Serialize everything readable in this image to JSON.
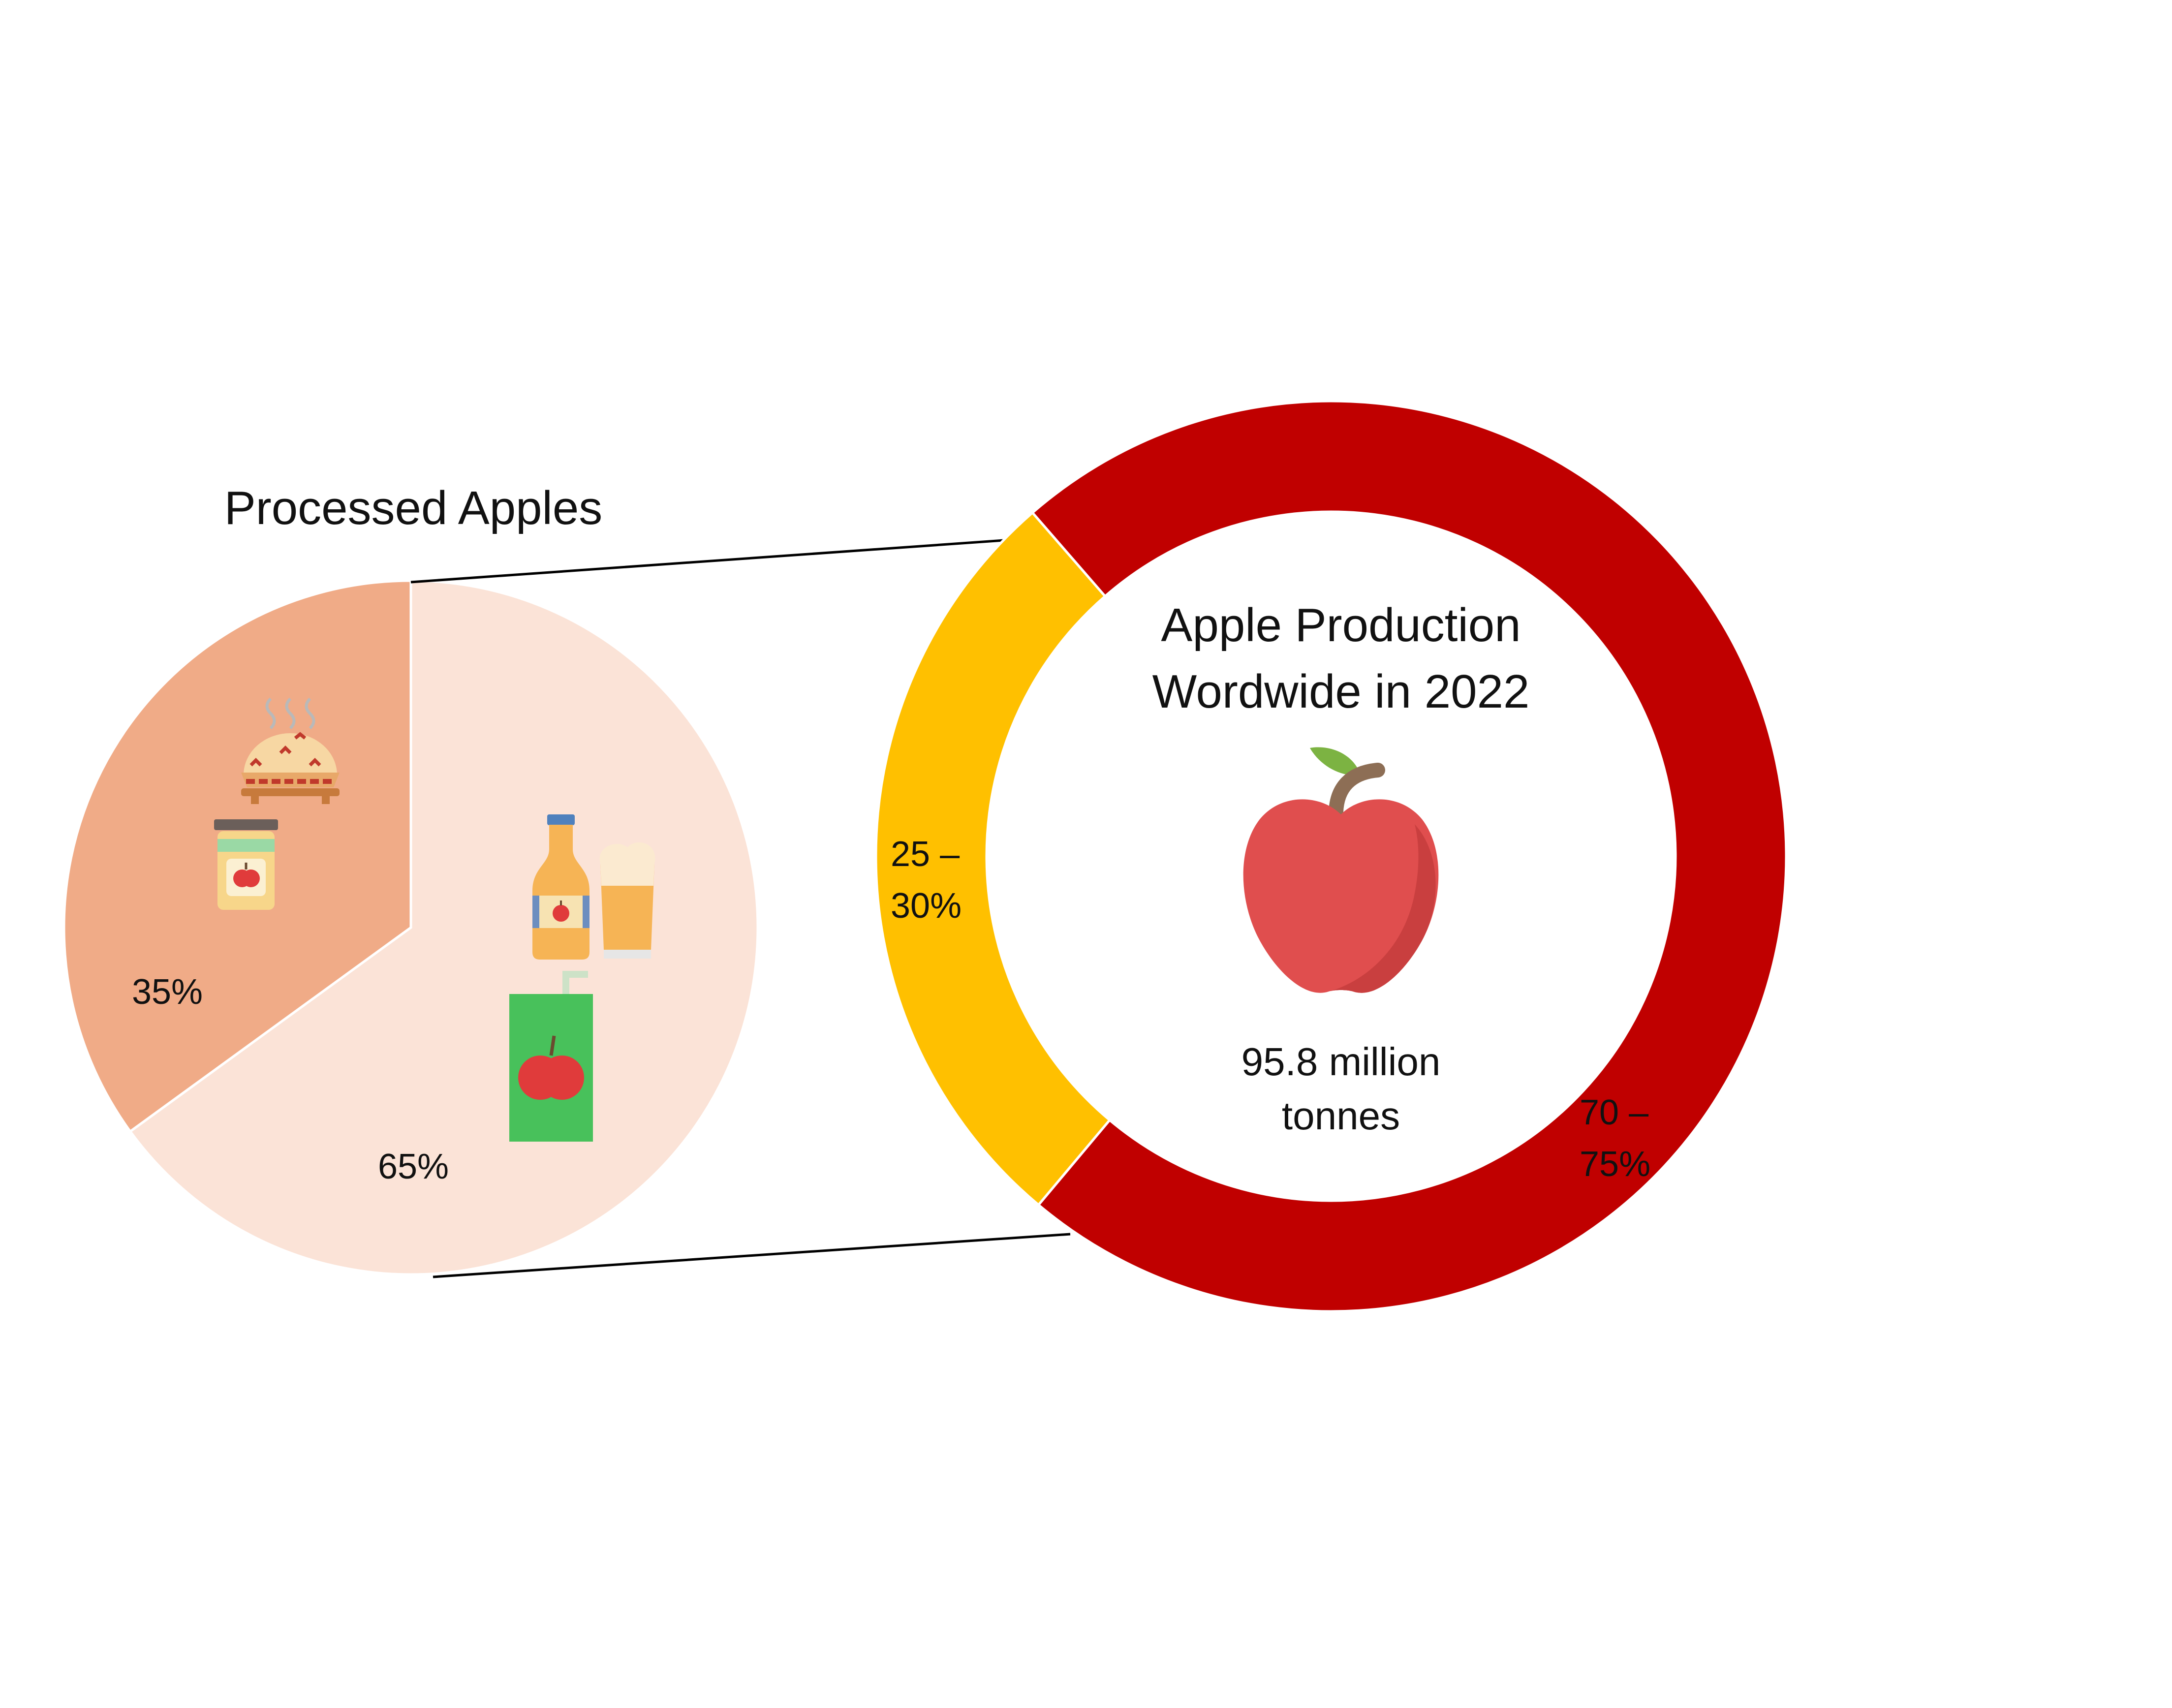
{
  "chart_data": [
    {
      "type": "pie",
      "title": "Processed Apples",
      "slices": [
        {
          "label": "35%",
          "value": 35,
          "color": "#F0AB87",
          "icons": [
            "apple-pie-icon",
            "apple-jam-jar-icon"
          ]
        },
        {
          "label": "65%",
          "value": 65,
          "color": "#FBE3D7",
          "icons": [
            "cider-bottle-icon",
            "beer-glass-icon",
            "juice-box-icon"
          ]
        }
      ]
    },
    {
      "type": "pie",
      "variant": "donut",
      "title": "Apple Production Wordwide in 2022",
      "center_icon": "apple-icon",
      "center_value": "95.8 million tonnes",
      "slices": [
        {
          "label": "25 – 30%",
          "value_range": [
            25,
            30
          ],
          "color": "#FFC000"
        },
        {
          "label": "70 – 75%",
          "value_range": [
            70,
            75
          ],
          "color": "#C00000"
        }
      ]
    }
  ],
  "colors": {
    "connector": "#000000",
    "slice_border": "#ffffff"
  }
}
